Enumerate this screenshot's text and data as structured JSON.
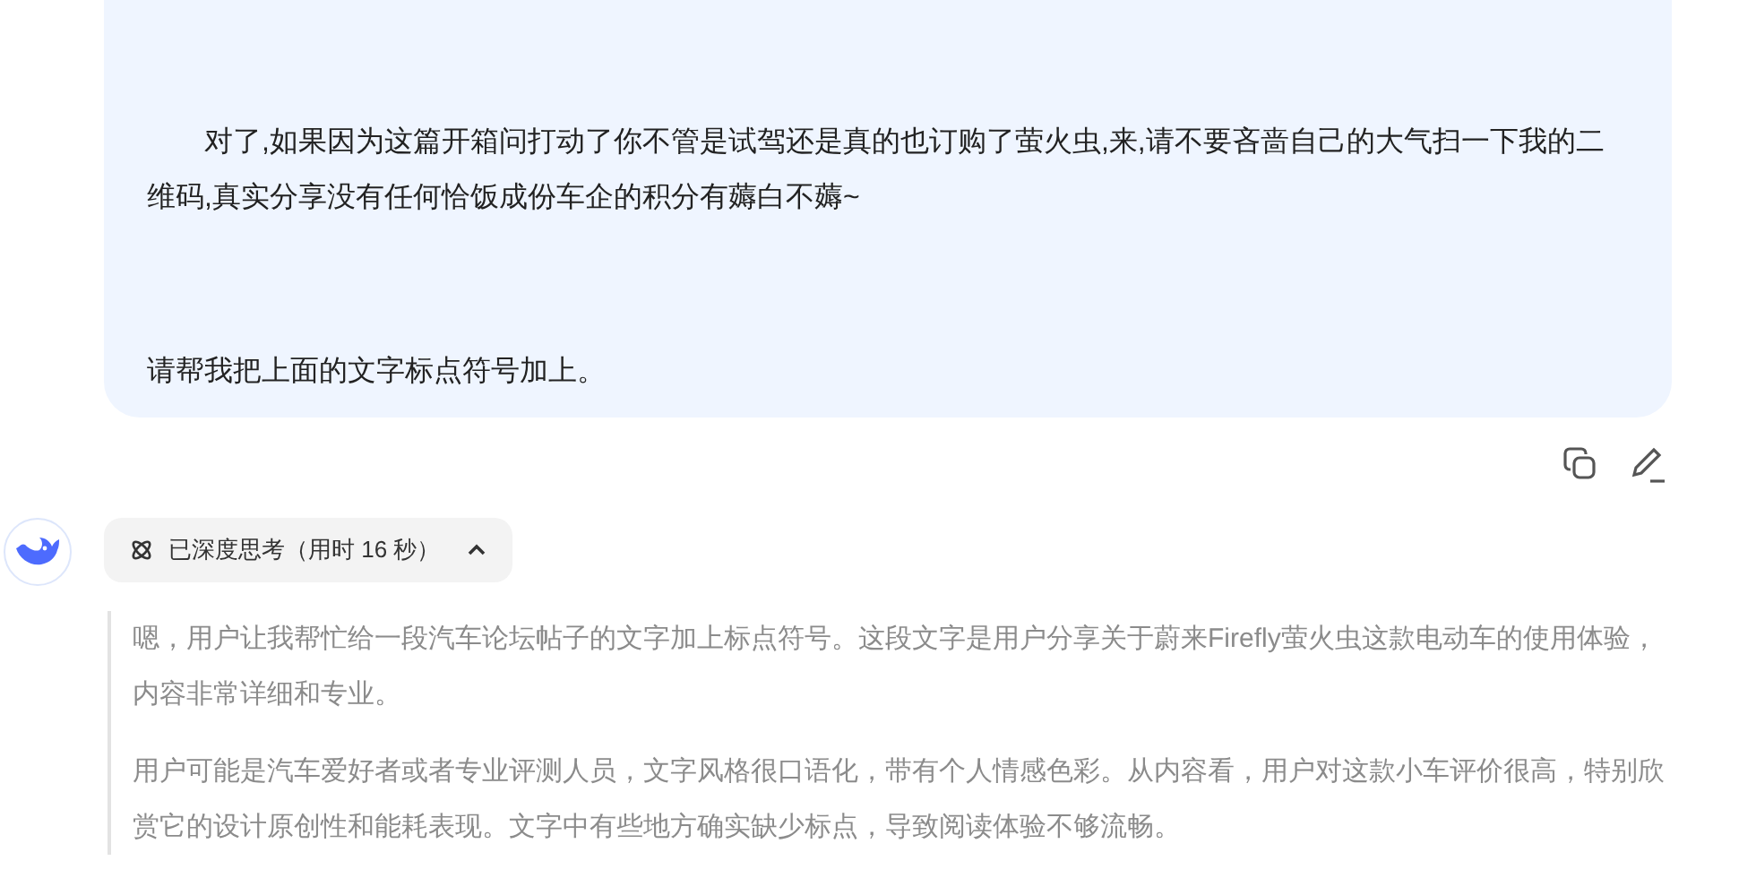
{
  "user_message": {
    "paragraphs": [
      "　　对了,如果因为这篇开箱问打动了你不管是试驾还是真的也订购了萤火虫,来,请不要吝啬自己的大气扫一下我的二维码,真实分享没有任何恰饭成份车企的积分有薅白不薅~",
      "请帮我把上面的文字标点符号加上。"
    ]
  },
  "message_actions": [
    {
      "kind": "copy"
    },
    {
      "kind": "edit"
    }
  ],
  "thinking": {
    "label": "已深度思考（用时 16 秒）",
    "expanded": true,
    "paragraphs": [
      "嗯，用户让我帮忙给一段汽车论坛帖子的文字加上标点符号。这段文字是用户分享关于蔚来Firefly萤火虫这款电动车的使用体验，内容非常详细和专业。",
      "用户可能是汽车爱好者或者专业评测人员，文字风格很口语化，带有个人情感色彩。从内容看，用户对这款小车评价很高，特别欣赏它的设计原创性和能耗表现。文字中有些地方确实缺少标点，导致阅读体验不够流畅。"
    ]
  }
}
